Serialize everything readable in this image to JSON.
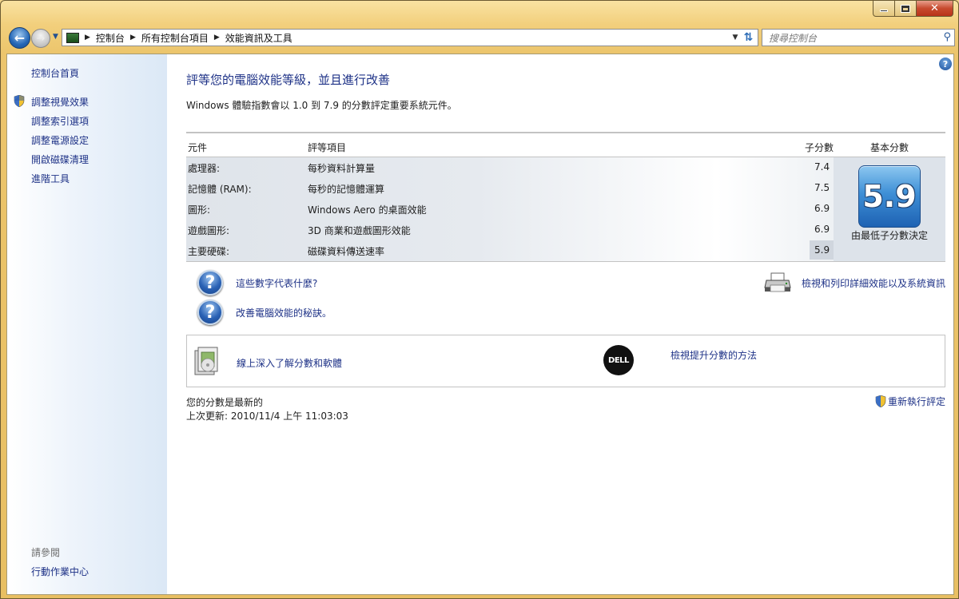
{
  "window": {
    "buttons": {
      "minimize": "minimize",
      "maximize": "maximize",
      "close": "✕"
    }
  },
  "navbar": {
    "breadcrumbs": [
      "控制台",
      "所有控制台項目",
      "效能資訊及工具"
    ],
    "search_placeholder": "搜尋控制台"
  },
  "sidebar": {
    "home": "控制台首頁",
    "items": [
      "調整視覺效果",
      "調整索引選項",
      "調整電源設定",
      "開啟磁碟清理",
      "進階工具"
    ],
    "see_also_label": "請參閱",
    "see_also_items": [
      "行動作業中心"
    ]
  },
  "main": {
    "title": "評等您的電腦效能等級，並且進行改善",
    "description": "Windows 體驗指數會以 1.0 到 7.9 的分數評定重要系統元件。",
    "table": {
      "headers": {
        "component": "元件",
        "rating": "評等項目",
        "subscore": "子分數",
        "basescore": "基本分數"
      },
      "rows": [
        {
          "component": "處理器:",
          "rating": "每秒資料計算量",
          "subscore": "7.4"
        },
        {
          "component": "記憶體 (RAM):",
          "rating": "每秒的記憶體運算",
          "subscore": "7.5"
        },
        {
          "component": "圖形:",
          "rating": "Windows Aero 的桌面效能",
          "subscore": "6.9"
        },
        {
          "component": "遊戲圖形:",
          "rating": "3D 商業和遊戲圖形效能",
          "subscore": "6.9"
        },
        {
          "component": "主要硬碟:",
          "rating": "磁碟資料傳送速率",
          "subscore": "5.9"
        }
      ],
      "base_score": "5.9",
      "base_caption": "由最低子分數決定"
    },
    "help_links": [
      "這些數字代表什麼?",
      "改善電腦效能的秘訣。"
    ],
    "print_link": "檢視和列印詳細效能以及系統資訊",
    "online_links": {
      "learn": "線上深入了解分數和軟體",
      "upgrade": "檢視提升分數的方法"
    },
    "dell_logo": "DELL",
    "status": {
      "line1": "您的分數是最新的",
      "line2": "上次更新: 2010/11/4 上午 11:03:03"
    },
    "rerun": "重新執行評定"
  }
}
